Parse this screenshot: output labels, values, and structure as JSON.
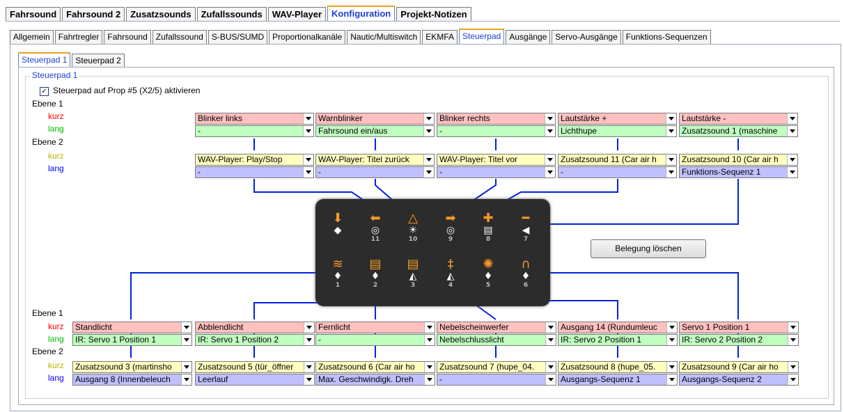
{
  "main_tabs": [
    "Fahrsound",
    "Fahrsound 2",
    "Zusatzsounds",
    "Zufallssounds",
    "WAV-Player",
    "Konfiguration",
    "Projekt-Notizen"
  ],
  "sub_tabs": [
    "Allgemein",
    "Fahrtregler",
    "Fahrsound",
    "Zufallssound",
    "S-BUS/SUMD",
    "Proportionalkanäle",
    "Nautic/Multiswitch",
    "EKMFA",
    "Steuerpad",
    "Ausgänge",
    "Servo-Ausgänge",
    "Funktions-Sequenzen"
  ],
  "pad_tabs": [
    "Steuerpad 1",
    "Steuerpad 2"
  ],
  "group_title": "Steuerpad 1",
  "activate_label": "Steuerpad auf Prop #5 (X2/5) aktivieren",
  "activate_checked": true,
  "labels": {
    "ebene1": "Ebene 1",
    "ebene2": "Ebene 2",
    "kurz": "kurz",
    "lang": "lang"
  },
  "top": {
    "e1_kurz": [
      "Blinker links",
      "Warnblinker",
      "Blinker rechts",
      "Lautstärke +",
      "Lautstärke -"
    ],
    "e1_lang": [
      "-",
      "Fahrsound ein/aus",
      "-",
      "Lichthupe",
      "Zusatzsound 1 (maschine"
    ],
    "e2_kurz": [
      "WAV-Player: Play/Stop",
      "WAV-Player: Titel zurück",
      "WAV-Player: Titel vor",
      "Zusatzsound 11 (Car air h",
      "Zusatzsound 10 (Car air h"
    ],
    "e2_lang": [
      "-",
      "-",
      "-",
      "-",
      "Funktions-Sequenz 1"
    ]
  },
  "bottom": {
    "e1_kurz": [
      "Standlicht",
      "Abblendlicht",
      "Fernlicht",
      "Nebelscheinwerfer",
      "Ausgang 14 (Rundumleuc",
      "Servo 1 Position 1"
    ],
    "e1_lang": [
      "IR: Servo 1 Position 1",
      "IR: Servo 1 Position 2",
      "-",
      "Nebelschlusslicht",
      "IR: Servo 2 Position 1",
      "IR: Servo 2 Position 2"
    ],
    "e2_kurz": [
      "Zusatzsound 3 (martinsho",
      "Zusatzsound 5 (tür_öffner",
      "Zusatzsound 6 (Car air ho",
      "Zusatzsound 7 (hupe_04.",
      "Zusatzsound 8 (hupe_05.",
      "Zusatzsound 9 (Car air ho"
    ],
    "e2_lang": [
      "Ausgang 8 (Innenbeleuch",
      "Leerlauf",
      "Max. Geschwindigk. Dreh",
      "-",
      "Ausgangs-Sequenz 1",
      "Ausgangs-Sequenz 2"
    ]
  },
  "pad_keys_top": [
    {
      "icon": "layers-down-icon",
      "num": ""
    },
    {
      "icon": "arrow-left-icon",
      "num": "11"
    },
    {
      "icon": "warning-triangle-icon",
      "num": "10"
    },
    {
      "icon": "arrow-right-icon",
      "num": "9"
    },
    {
      "icon": "plus-icon",
      "num": "8"
    },
    {
      "icon": "minus-icon",
      "num": "7"
    }
  ],
  "pad_keys_bottom": [
    {
      "icon": "parking-light-icon",
      "num": "1"
    },
    {
      "icon": "low-beam-icon",
      "num": "2"
    },
    {
      "icon": "high-beam-icon",
      "num": "3"
    },
    {
      "icon": "fog-light-icon",
      "num": "4"
    },
    {
      "icon": "beacon-icon",
      "num": "5"
    },
    {
      "icon": "rear-fog-icon",
      "num": "6"
    }
  ],
  "clear_button": "Belegung löschen",
  "colors": {
    "kurz": "#ff0000",
    "lang_e1": "#00bb00",
    "kurz_e2": "#b6b600",
    "lang_e2": "#0000ff",
    "line": "#0022dd"
  }
}
